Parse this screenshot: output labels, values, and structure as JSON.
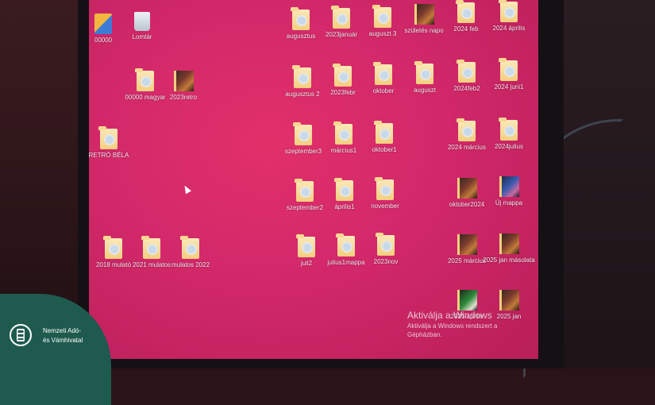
{
  "desktop": {
    "icons": [
      {
        "label": "00000",
        "kind": "shortcut"
      },
      {
        "label": "Lomtár",
        "kind": "bin"
      },
      {
        "label": "00000 magyar",
        "kind": "folder"
      },
      {
        "label": "2023retro",
        "kind": "media"
      },
      {
        "label": "RETRÓ BÉLA",
        "kind": "folder"
      },
      {
        "label": "2018 mulató",
        "kind": "folder"
      },
      {
        "label": "2021 mulatos",
        "kind": "folder"
      },
      {
        "label": "mulatos 2022",
        "kind": "folder"
      },
      {
        "label": "augusztus",
        "kind": "folder"
      },
      {
        "label": "2023január",
        "kind": "folder"
      },
      {
        "label": "auguszt 3",
        "kind": "folder"
      },
      {
        "label": "születés napo",
        "kind": "media"
      },
      {
        "label": "2024 feb",
        "kind": "folder"
      },
      {
        "label": "2024 április",
        "kind": "folder"
      },
      {
        "label": "augusztus 2",
        "kind": "folder"
      },
      {
        "label": "2023febr",
        "kind": "folder"
      },
      {
        "label": "oktober",
        "kind": "folder"
      },
      {
        "label": "auguszt",
        "kind": "folder"
      },
      {
        "label": "2024feb2",
        "kind": "folder"
      },
      {
        "label": "2024 juni1",
        "kind": "folder"
      },
      {
        "label": "szeptember3",
        "kind": "folder"
      },
      {
        "label": "március1",
        "kind": "folder"
      },
      {
        "label": "oktober1",
        "kind": "folder"
      },
      {
        "label": "2024 március",
        "kind": "folder"
      },
      {
        "label": "2024julius",
        "kind": "folder"
      },
      {
        "label": "szeptember2",
        "kind": "folder"
      },
      {
        "label": "április1",
        "kind": "folder"
      },
      {
        "label": "november",
        "kind": "folder"
      },
      {
        "label": "oktober2024",
        "kind": "media"
      },
      {
        "label": "Új mappa",
        "kind": "media-blue"
      },
      {
        "label": "juli2",
        "kind": "folder"
      },
      {
        "label": "julius1mappa",
        "kind": "folder"
      },
      {
        "label": "2023nov",
        "kind": "folder"
      },
      {
        "label": "2025 március",
        "kind": "media"
      },
      {
        "label": "2025 jan másolata",
        "kind": "media"
      },
      {
        "label": "2025 április",
        "kind": "media-green"
      },
      {
        "label": "2025 jan",
        "kind": "media"
      }
    ]
  },
  "activation": {
    "title": "Aktiválja a Windows",
    "message": "Aktiválja a Windows rendszert a Gépházban."
  },
  "watermark": {
    "org_line1": "Nemzeti Adó-",
    "org_line2": "és Vámhivatal"
  }
}
